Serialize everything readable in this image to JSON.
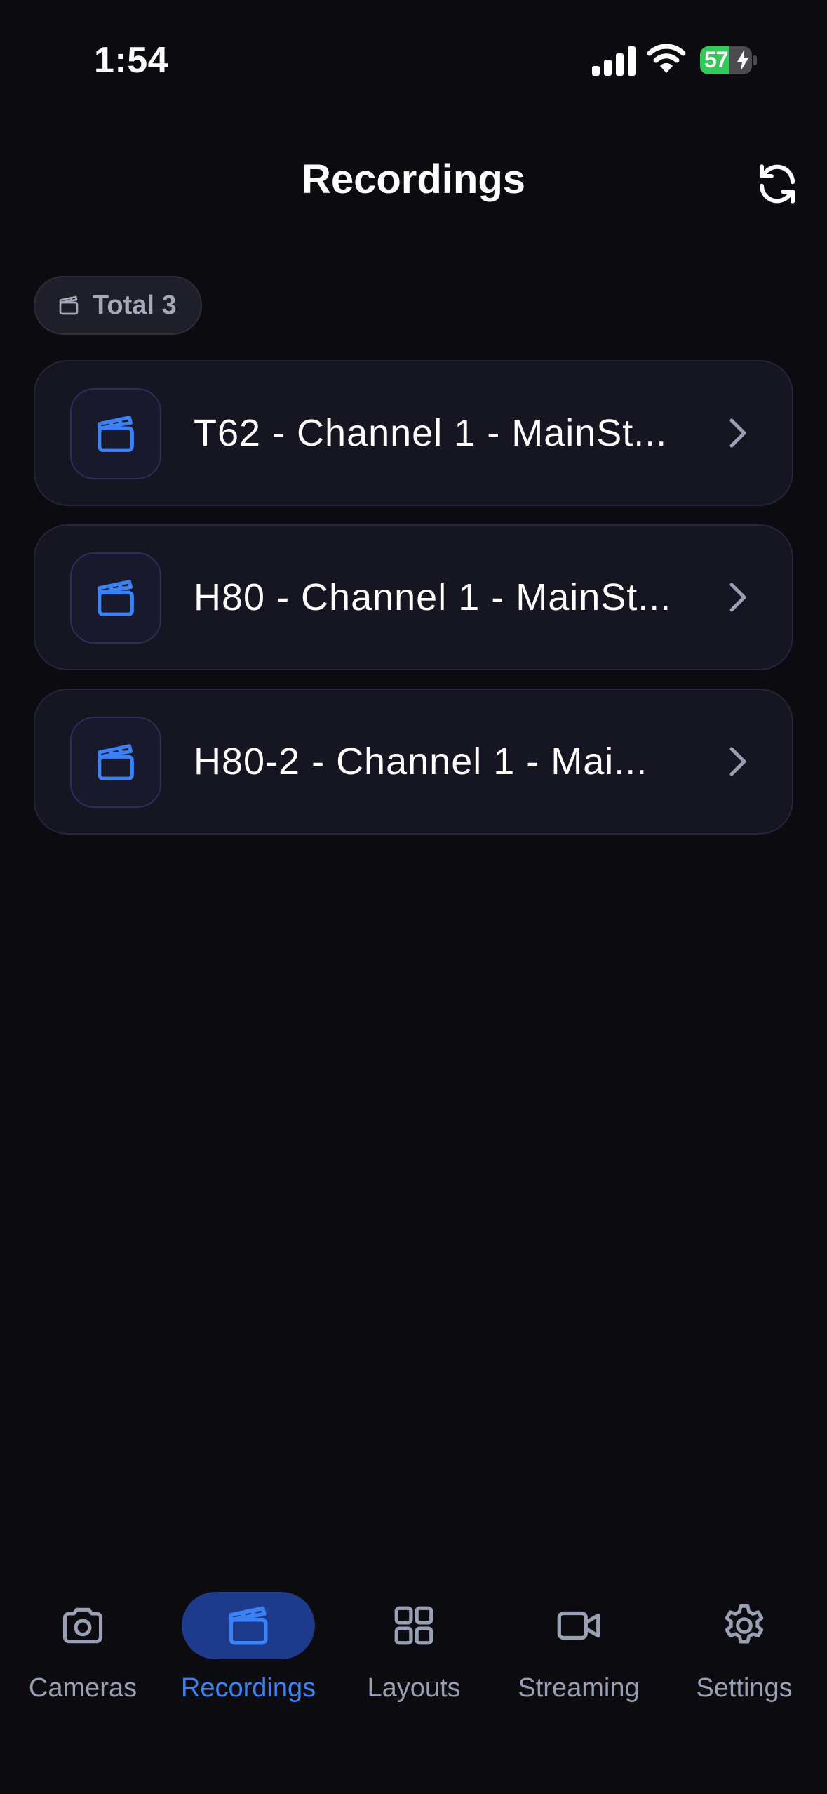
{
  "status_bar": {
    "time": "1:54",
    "battery_level": "57",
    "battery_fraction": 0.57,
    "signal_icon": "cellular-signal-icon",
    "wifi_icon": "wifi-icon",
    "battery_icon": "battery-charging-icon"
  },
  "header": {
    "title": "Recordings",
    "refresh_icon": "refresh-icon"
  },
  "summary": {
    "total_label": "Total 3",
    "icon": "clapperboard-icon"
  },
  "recordings": [
    {
      "title": "T62 - Channel 1 - MainSt...",
      "icon": "clapperboard-icon"
    },
    {
      "title": "H80 - Channel 1 - MainSt...",
      "icon": "clapperboard-icon"
    },
    {
      "title": "H80-2 - Channel 1 - Mai...",
      "icon": "clapperboard-icon"
    }
  ],
  "tab_bar": {
    "active_tab": "Recordings",
    "tabs": [
      {
        "label": "Cameras",
        "icon": "camera-icon"
      },
      {
        "label": "Recordings",
        "icon": "clapperboard-icon"
      },
      {
        "label": "Layouts",
        "icon": "grid-icon"
      },
      {
        "label": "Streaming",
        "icon": "video-icon"
      },
      {
        "label": "Settings",
        "icon": "gear-icon"
      }
    ]
  },
  "colors": {
    "background": "#0b0b10",
    "card": "#151621",
    "accent": "#3b82f6",
    "active_tab_bg": "#1e3a8a",
    "muted_text": "#9aa0b4",
    "battery_green": "#34c759"
  }
}
